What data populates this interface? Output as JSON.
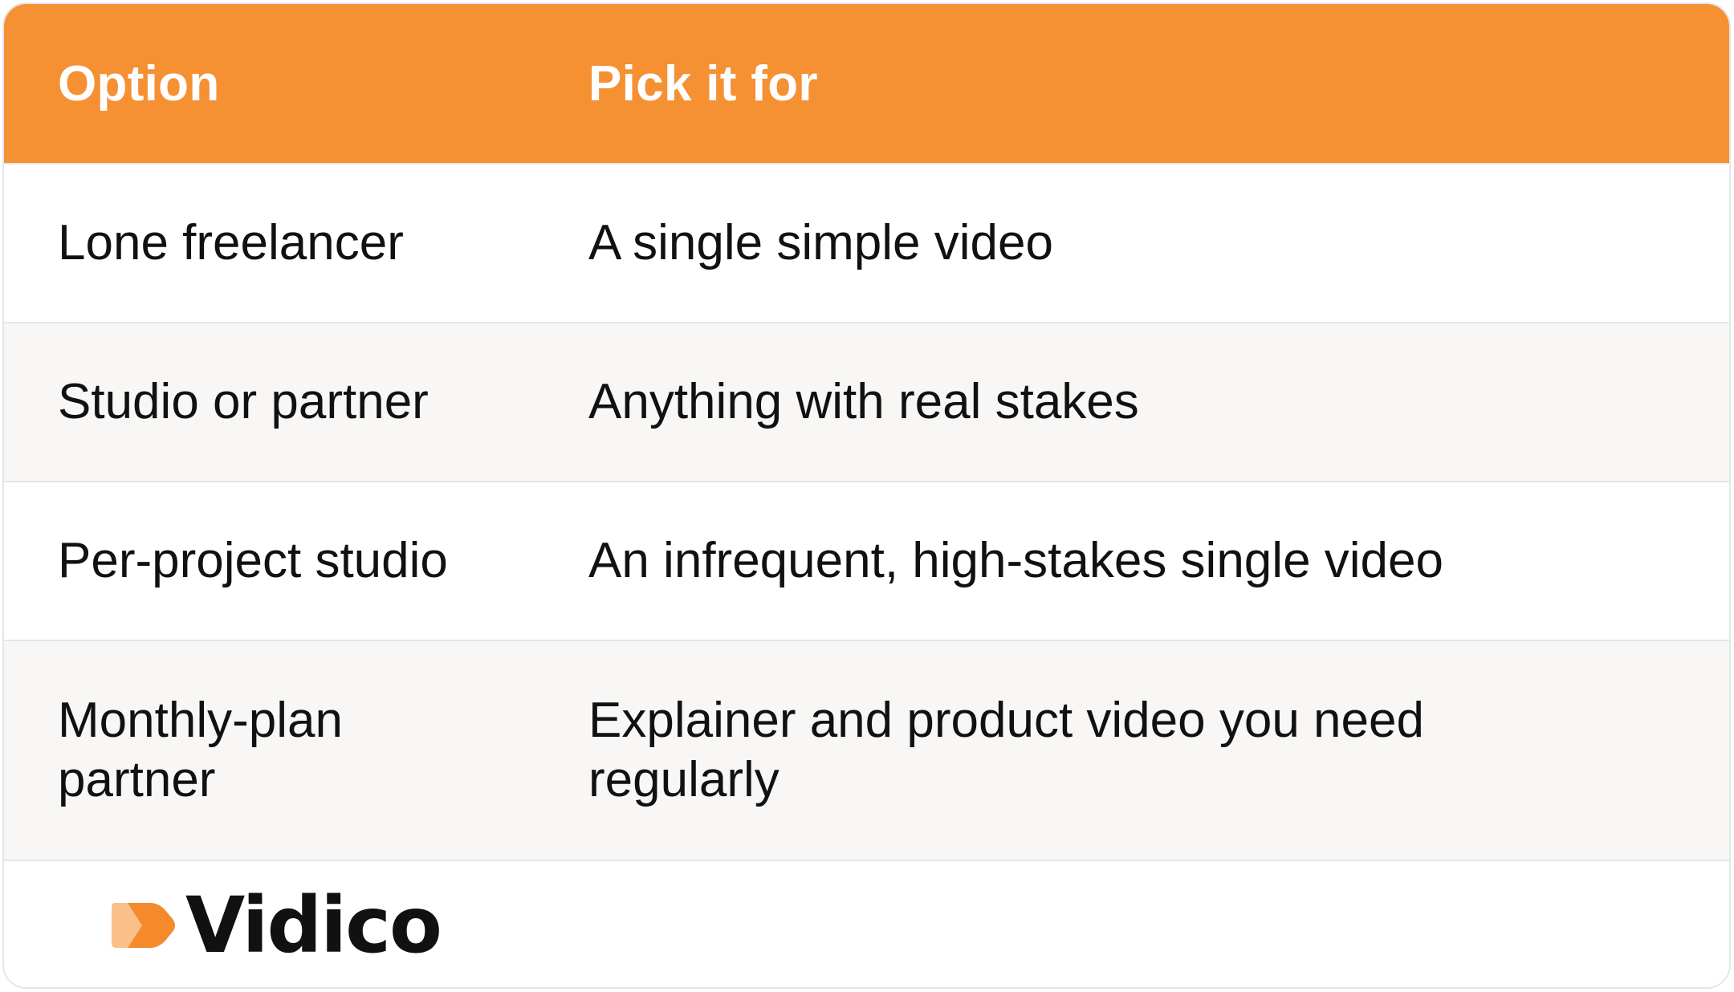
{
  "table": {
    "headers": [
      "Option",
      "Pick it for"
    ],
    "rows": [
      [
        "Lone freelancer",
        "A single simple video"
      ],
      [
        "Studio or partner",
        "Anything with real stakes"
      ],
      [
        "Per-project studio",
        "An infrequent, high-stakes single video"
      ],
      [
        "Monthly-plan partner",
        "Explainer and product video you need regularly"
      ]
    ]
  },
  "branding": {
    "logo_text": "Vidico",
    "logo_icon": "play-arrow-logo-icon"
  },
  "colors": {
    "accent": "#f59033",
    "header_text": "#ffffff",
    "body_text": "#111111",
    "row_alt": "#f8f7f5",
    "border": "#e2e6ea"
  }
}
